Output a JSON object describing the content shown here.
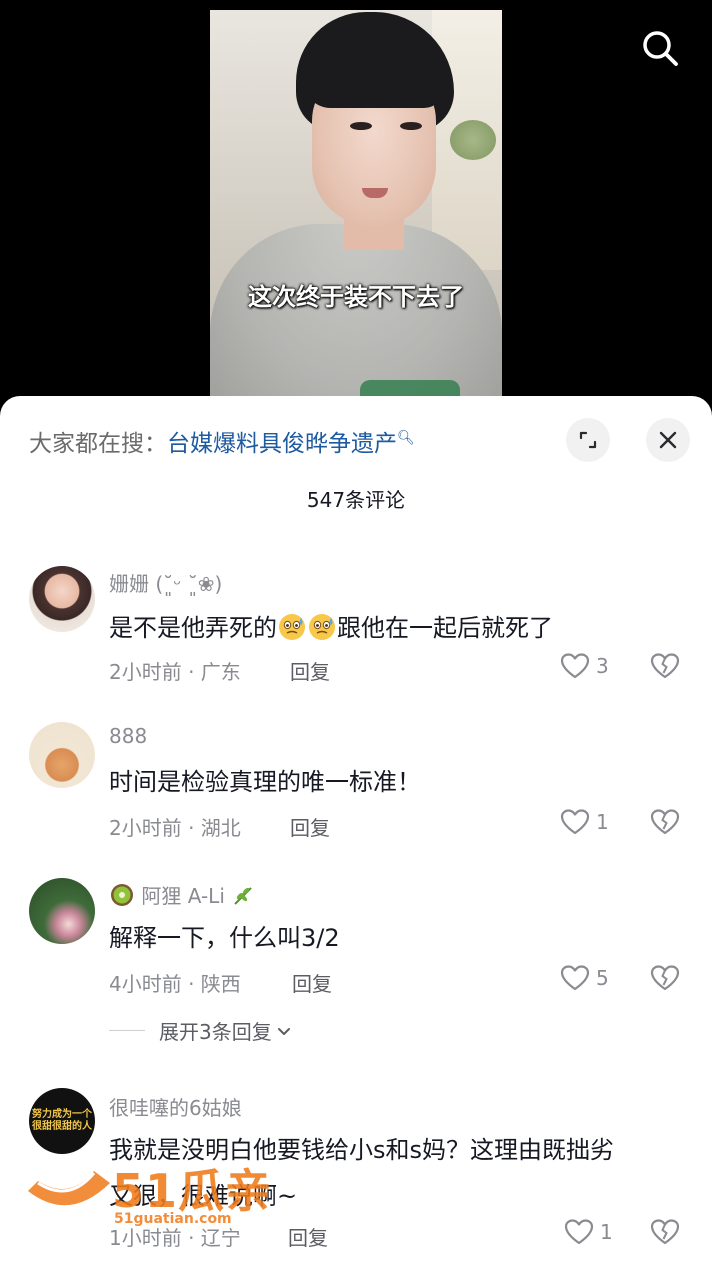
{
  "video": {
    "subtitle": "这次终于装不下去了"
  },
  "sheet": {
    "hot_search_prefix": "大家都在搜：",
    "hot_search_keyword": "台媒爆料具俊晔争遗产",
    "comment_count_title": "547条评论"
  },
  "comments": [
    {
      "username": "姗姗 (˘͈ᵕ ˘͈❀)",
      "text_before": "是不是他弄死的",
      "text_after": "跟他在一起后就死了",
      "emoji": "cold-sweat-emoji",
      "meta": "2小时前 · 广东",
      "reply_label": "回复",
      "likes": "3"
    },
    {
      "username": "888",
      "text": "时间是检验真理的唯一标准！",
      "meta": "2小时前 · 湖北",
      "reply_label": "回复",
      "likes": "1"
    },
    {
      "username": "阿狸 A-Li",
      "name_prefix_emoji": "kiwi-emoji",
      "name_suffix_emoji": "herb-emoji",
      "text": "解释一下，什么叫3/2",
      "meta": "4小时前 · 陕西",
      "reply_label": "回复",
      "likes": "5",
      "expand_label": "展开3条回复"
    },
    {
      "username": "很哇噻的6姑娘",
      "avatar_text_line1": "努力成为一个",
      "avatar_text_line2": "很甜很甜的人",
      "text_line1": "我就是没明白他要钱给小s和s妈？这理由既拙劣",
      "text_line2": "又狠，很难说啊~",
      "meta": "1小时前 · 辽宁",
      "reply_label": "回复",
      "likes": "1"
    }
  ],
  "watermark": {
    "brand": "51瓜亲",
    "url": "51guatian.com"
  },
  "colors": {
    "link_blue": "#1e5aa0",
    "text_primary": "#161823",
    "text_secondary": "#8a8b91",
    "watermark_orange": "#f07a1a"
  }
}
